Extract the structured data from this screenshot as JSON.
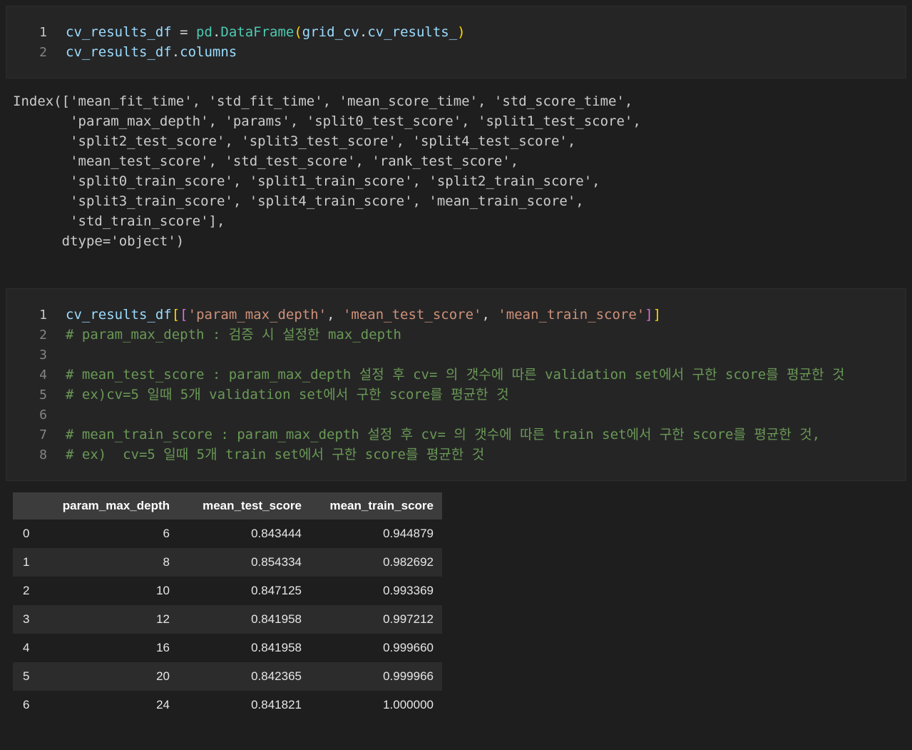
{
  "colors": {
    "var": "#9cdcfe",
    "plain": "#d4d4d4",
    "cls": "#4ec9b0",
    "str": "#ce9178",
    "com": "#6a9955",
    "b1": "#ffd700",
    "b2": "#da70d6"
  },
  "cells": [
    {
      "name": "code-cell-1",
      "lines": [
        {
          "n": "1",
          "tokens": [
            {
              "t": "cv_results_df",
              "c": "var"
            },
            {
              "t": " = ",
              "c": "plain"
            },
            {
              "t": "pd",
              "c": "cls"
            },
            {
              "t": ".",
              "c": "plain"
            },
            {
              "t": "DataFrame",
              "c": "cls"
            },
            {
              "t": "(",
              "c": "b1"
            },
            {
              "t": "grid_cv",
              "c": "var"
            },
            {
              "t": ".",
              "c": "plain"
            },
            {
              "t": "cv_results_",
              "c": "var"
            },
            {
              "t": ")",
              "c": "b1"
            }
          ]
        },
        {
          "n": "2",
          "tokens": [
            {
              "t": "cv_results_df",
              "c": "var"
            },
            {
              "t": ".",
              "c": "plain"
            },
            {
              "t": "columns",
              "c": "var"
            }
          ]
        }
      ]
    },
    {
      "name": "code-cell-2",
      "lines": [
        {
          "n": "1",
          "tokens": [
            {
              "t": "cv_results_df",
              "c": "var"
            },
            {
              "t": "[",
              "c": "b1"
            },
            {
              "t": "[",
              "c": "b2"
            },
            {
              "t": "'param_max_depth'",
              "c": "str"
            },
            {
              "t": ", ",
              "c": "plain"
            },
            {
              "t": "'mean_test_score'",
              "c": "str"
            },
            {
              "t": ", ",
              "c": "plain"
            },
            {
              "t": "'mean_train_score'",
              "c": "str"
            },
            {
              "t": "]",
              "c": "b2"
            },
            {
              "t": "]",
              "c": "b1"
            }
          ]
        },
        {
          "n": "2",
          "tokens": [
            {
              "t": "# param_max_depth : 검증 시 설정한 max_depth",
              "c": "com"
            }
          ]
        },
        {
          "n": "3",
          "tokens": []
        },
        {
          "n": "4",
          "tokens": [
            {
              "t": "# mean_test_score : param_max_depth 설정 후 cv= 의 갯수에 따른 validation set에서 구한 score를 평균한 것",
              "c": "com"
            }
          ]
        },
        {
          "n": "5",
          "tokens": [
            {
              "t": "# ex)cv=5 일때 5개 validation set에서 구한 score를 평균한 것",
              "c": "com"
            }
          ]
        },
        {
          "n": "6",
          "tokens": []
        },
        {
          "n": "7",
          "tokens": [
            {
              "t": "# mean_train_score : param_max_depth 설정 후 cv= 의 갯수에 따른 train set에서 구한 score를 평균한 것,",
              "c": "com"
            }
          ]
        },
        {
          "n": "8",
          "tokens": [
            {
              "t": "# ex)  cv=5 일때 5개 train set에서 구한 score를 평균한 것",
              "c": "com"
            }
          ]
        }
      ]
    }
  ],
  "outputs": {
    "index_repr": "Index(['mean_fit_time', 'std_fit_time', 'mean_score_time', 'std_score_time',\n       'param_max_depth', 'params', 'split0_test_score', 'split1_test_score',\n       'split2_test_score', 'split3_test_score', 'split4_test_score',\n       'mean_test_score', 'std_test_score', 'rank_test_score',\n       'split0_train_score', 'split1_train_score', 'split2_train_score',\n       'split3_train_score', 'split4_train_score', 'mean_train_score',\n       'std_train_score'],\n      dtype='object')"
  },
  "table": {
    "index_header": "",
    "columns": [
      "param_max_depth",
      "mean_test_score",
      "mean_train_score"
    ],
    "rows": [
      {
        "index": "0",
        "values": [
          "6",
          "0.843444",
          "0.944879"
        ]
      },
      {
        "index": "1",
        "values": [
          "8",
          "0.854334",
          "0.982692"
        ]
      },
      {
        "index": "2",
        "values": [
          "10",
          "0.847125",
          "0.993369"
        ]
      },
      {
        "index": "3",
        "values": [
          "12",
          "0.841958",
          "0.997212"
        ]
      },
      {
        "index": "4",
        "values": [
          "16",
          "0.841958",
          "0.999660"
        ]
      },
      {
        "index": "5",
        "values": [
          "20",
          "0.842365",
          "0.999966"
        ]
      },
      {
        "index": "6",
        "values": [
          "24",
          "0.841821",
          "1.000000"
        ]
      }
    ]
  }
}
